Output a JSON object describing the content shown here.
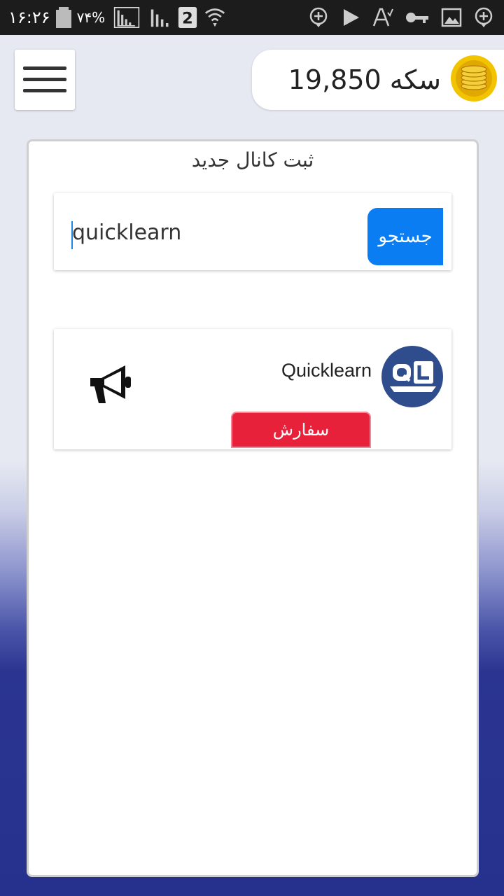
{
  "status_bar": {
    "time": "۱۶:۲۶",
    "battery": "۷۴%",
    "sim_badge": "2",
    "left_icons": [
      "battery-icon",
      "signal-icon",
      "signal-icon",
      "sim-2-icon",
      "wifi-icon"
    ],
    "right_icons": [
      "add-circle-icon",
      "play-store-icon",
      "font-icon",
      "key-icon",
      "image-icon",
      "add-circle-icon"
    ]
  },
  "header": {
    "coin_label": "سکه 19,850",
    "menu_icon": "hamburger-menu-icon",
    "coin_icon": "gold-coins-icon",
    "coin_color": "#f2c400"
  },
  "card": {
    "title": "ثبت کانال جدید"
  },
  "search": {
    "value": "quicklearn",
    "button_label": "جستجو",
    "button_color": "#0a7df2"
  },
  "result": {
    "channel_name": "Quicklearn",
    "avatar_icon": "quicklearn-logo-icon",
    "megaphone_icon": "megaphone-icon",
    "order_label": "سفارش",
    "order_color": "#e8213a"
  }
}
